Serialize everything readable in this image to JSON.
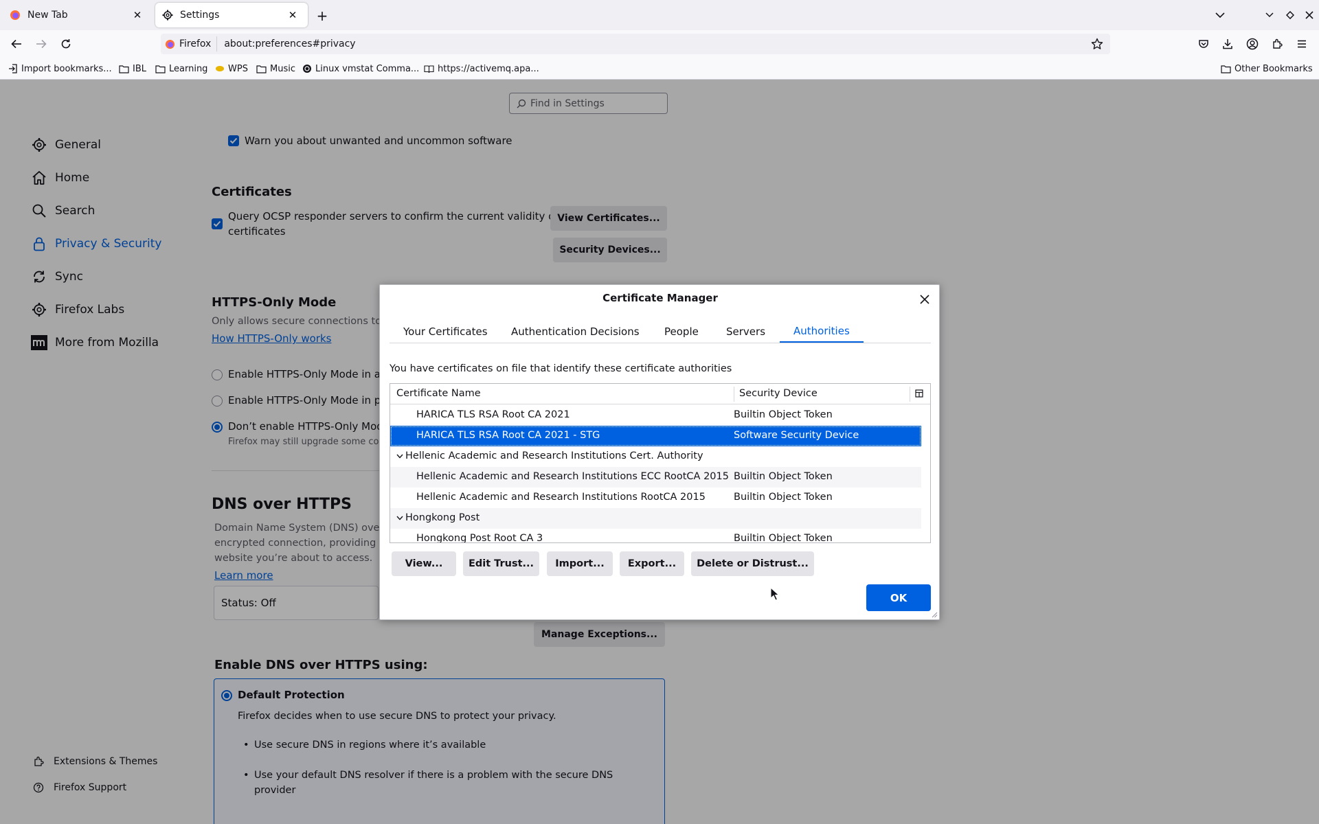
{
  "tabs": [
    {
      "title": "New Tab",
      "close": "✕"
    },
    {
      "title": "Settings",
      "close": "✕"
    }
  ],
  "new_tab_symbol": "+",
  "urlbar": {
    "identity": "Firefox",
    "url": "about:preferences#privacy"
  },
  "bookmarks": [
    {
      "label": "Import bookmarks...",
      "icon": "import-icon"
    },
    {
      "label": "IBL",
      "icon": "folder-icon"
    },
    {
      "label": "Learning",
      "icon": "folder-icon"
    },
    {
      "label": "WPS",
      "icon": "wps-icon"
    },
    {
      "label": "Music",
      "icon": "folder-icon"
    },
    {
      "label": "Linux vmstat Comma...",
      "icon": "site-icon"
    },
    {
      "label": "https://activemq.apa...",
      "icon": "book-icon"
    },
    {
      "label": "Other Bookmarks",
      "icon": "folder-icon"
    }
  ],
  "settings": {
    "find_placeholder": "Find in Settings",
    "sidebar": [
      {
        "label": "General"
      },
      {
        "label": "Home"
      },
      {
        "label": "Search"
      },
      {
        "label": "Privacy & Security"
      },
      {
        "label": "Sync"
      },
      {
        "label": "Firefox Labs"
      },
      {
        "label": "More from Mozilla"
      }
    ],
    "sidebar_footer": [
      {
        "label": "Extensions & Themes"
      },
      {
        "label": "Firefox Support"
      }
    ],
    "warn_unwanted": "Warn you about unwanted and uncommon software",
    "certificates_heading": "Certificates",
    "ocsp_line1": "Query OCSP responder servers to confirm the current validity of",
    "ocsp_line2": "certificates",
    "view_certificates": "View Certificates...",
    "security_devices": "Security Devices...",
    "https_heading": "HTTPS-Only Mode",
    "https_desc": "Only allows secure connections to",
    "https_link": "How HTTPS-Only works",
    "https_opt1": "Enable HTTPS-Only Mode in all",
    "https_opt2": "Enable HTTPS-Only Mode in pri",
    "https_opt3": "Don’t enable HTTPS-Only Mode",
    "https_opt3_sub": "Firefox may still upgrade some conn",
    "dns_heading": "DNS over HTTPS",
    "dns_desc1": "Domain Name System (DNS) over",
    "dns_desc2": "encrypted connection, providing a",
    "dns_desc3": "website you’re about to access.",
    "dns_learn": "Learn more",
    "dns_status": "Status: Off",
    "manage_exceptions": "Manage Exceptions...",
    "doh_using": "Enable DNS over HTTPS using:",
    "default_protection": "Default Protection",
    "default_desc": "Firefox decides when to use secure DNS to protect your privacy.",
    "bullet1": "Use secure DNS in regions where it’s available",
    "bullet2a": "Use your default DNS resolver if there is a problem with the secure DNS",
    "bullet2b": "provider"
  },
  "dialog": {
    "title": "Certificate Manager",
    "close": "✕",
    "tabs": [
      "Your Certificates",
      "Authentication Decisions",
      "People",
      "Servers",
      "Authorities"
    ],
    "active_tab": "Authorities",
    "description": "You have certificates on file that identify these certificate authorities",
    "columns": [
      "Certificate Name",
      "Security Device"
    ],
    "rows": [
      {
        "name": "HARICA TLS RSA Root CA 2021",
        "device": "Builtin Object Token",
        "level": 1,
        "selected": false
      },
      {
        "name": "HARICA TLS RSA Root CA 2021 - STG",
        "device": "Software Security Device",
        "level": 1,
        "selected": true
      },
      {
        "name": "Hellenic Academic and Research Institutions Cert. Authority",
        "device": "",
        "level": 0,
        "selected": false
      },
      {
        "name": "Hellenic Academic and Research Institutions ECC RootCA 2015",
        "device": "Builtin Object Token",
        "level": 1,
        "selected": false
      },
      {
        "name": "Hellenic Academic and Research Institutions RootCA 2015",
        "device": "Builtin Object Token",
        "level": 1,
        "selected": false
      },
      {
        "name": "Hongkong Post",
        "device": "",
        "level": 0,
        "selected": false
      },
      {
        "name": "Hongkong Post Root CA 3",
        "device": "Builtin Object Token",
        "level": 1,
        "selected": false
      }
    ],
    "buttons": [
      "View...",
      "Edit Trust...",
      "Import...",
      "Export...",
      "Delete or Distrust..."
    ],
    "ok": "OK"
  },
  "colors": {
    "accent": "#0061e0",
    "dim": "rgba(0,0,0,0.33)"
  }
}
